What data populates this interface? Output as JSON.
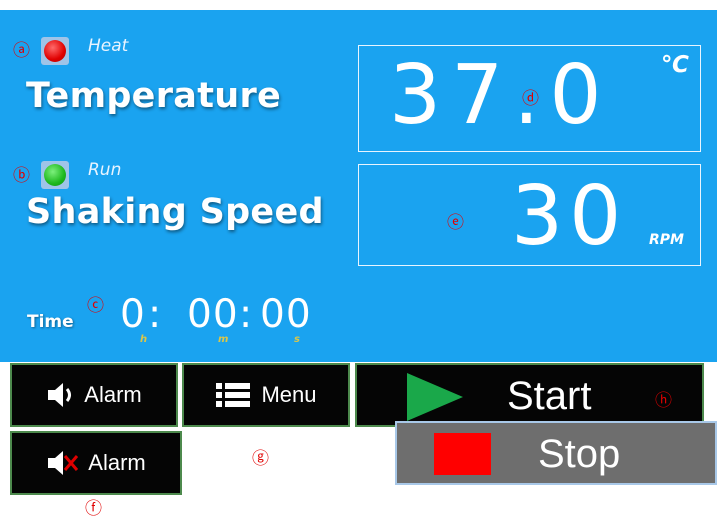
{
  "temperature": {
    "status": "Heat",
    "label": "Temperature",
    "value": "37.0",
    "unit": "℃"
  },
  "shaking": {
    "status": "Run",
    "label": "Shaking Speed",
    "value": "30",
    "unit": "RPM"
  },
  "time": {
    "label": "Time",
    "hours": "0",
    "minutes": "00",
    "seconds": "00",
    "hours_unit": "h",
    "minutes_unit": "m",
    "seconds_unit": "s"
  },
  "buttons": {
    "alarm_on_label": "Alarm",
    "menu_label": "Menu",
    "start_label": "Start",
    "stop_label": "Stop",
    "alarm_off_label": "Alarm"
  },
  "annotations": {
    "a": "ⓐ",
    "b": "ⓑ",
    "c": "ⓒ",
    "d": "ⓓ",
    "e": "ⓔ",
    "f": "ⓕ",
    "g": "ⓖ",
    "h": "ⓗ"
  },
  "colors": {
    "screen_bg": "#1aa3f0",
    "heat_led": "#e00000",
    "run_led": "#1db81d",
    "start_triangle": "#1aa84a",
    "stop_square": "#ff0000",
    "annotation": "#e00000"
  },
  "icons": {
    "alarm_on": "speaker-sound-icon",
    "alarm_off": "speaker-muted-icon",
    "menu": "menu-list-icon",
    "start": "play-triangle-icon",
    "stop": "stop-square-icon"
  }
}
